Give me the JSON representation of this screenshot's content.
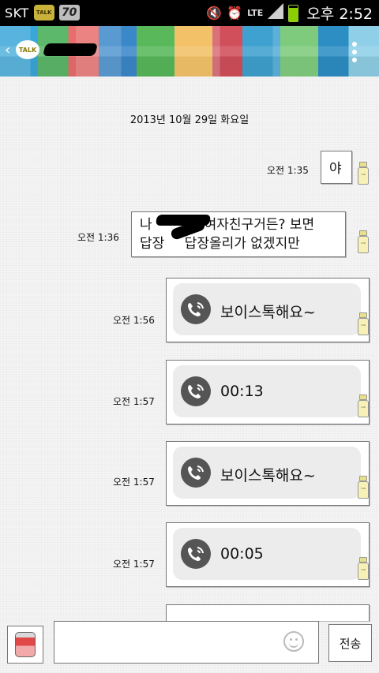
{
  "statusbar": {
    "carrier": "SKT",
    "talk_badge": "TALK",
    "badge_number": "70",
    "network": "LTE",
    "ampm": "오후",
    "time": "2:52"
  },
  "header": {
    "logo_text": "TALK"
  },
  "chat": {
    "date": "2013년 10월 29일 화요일",
    "messages": [
      {
        "time": "오전 1:35",
        "text": "야"
      },
      {
        "time": "오전 1:36",
        "line1_pre": "나",
        "line1_post": "여자친구거든? 보면",
        "line2_pre": "답장",
        "line2_post": " 답장올리가 없겠지만"
      },
      {
        "time": "오전 1:56",
        "voice_label": "보이스톡해요~"
      },
      {
        "time": "오전 1:57",
        "voice_label": "00:13"
      },
      {
        "time": "오전 1:57",
        "voice_label": "보이스톡해요~"
      },
      {
        "time": "오전 1:57",
        "voice_label": "00:05"
      }
    ]
  },
  "inputbar": {
    "send_label": "전송"
  }
}
